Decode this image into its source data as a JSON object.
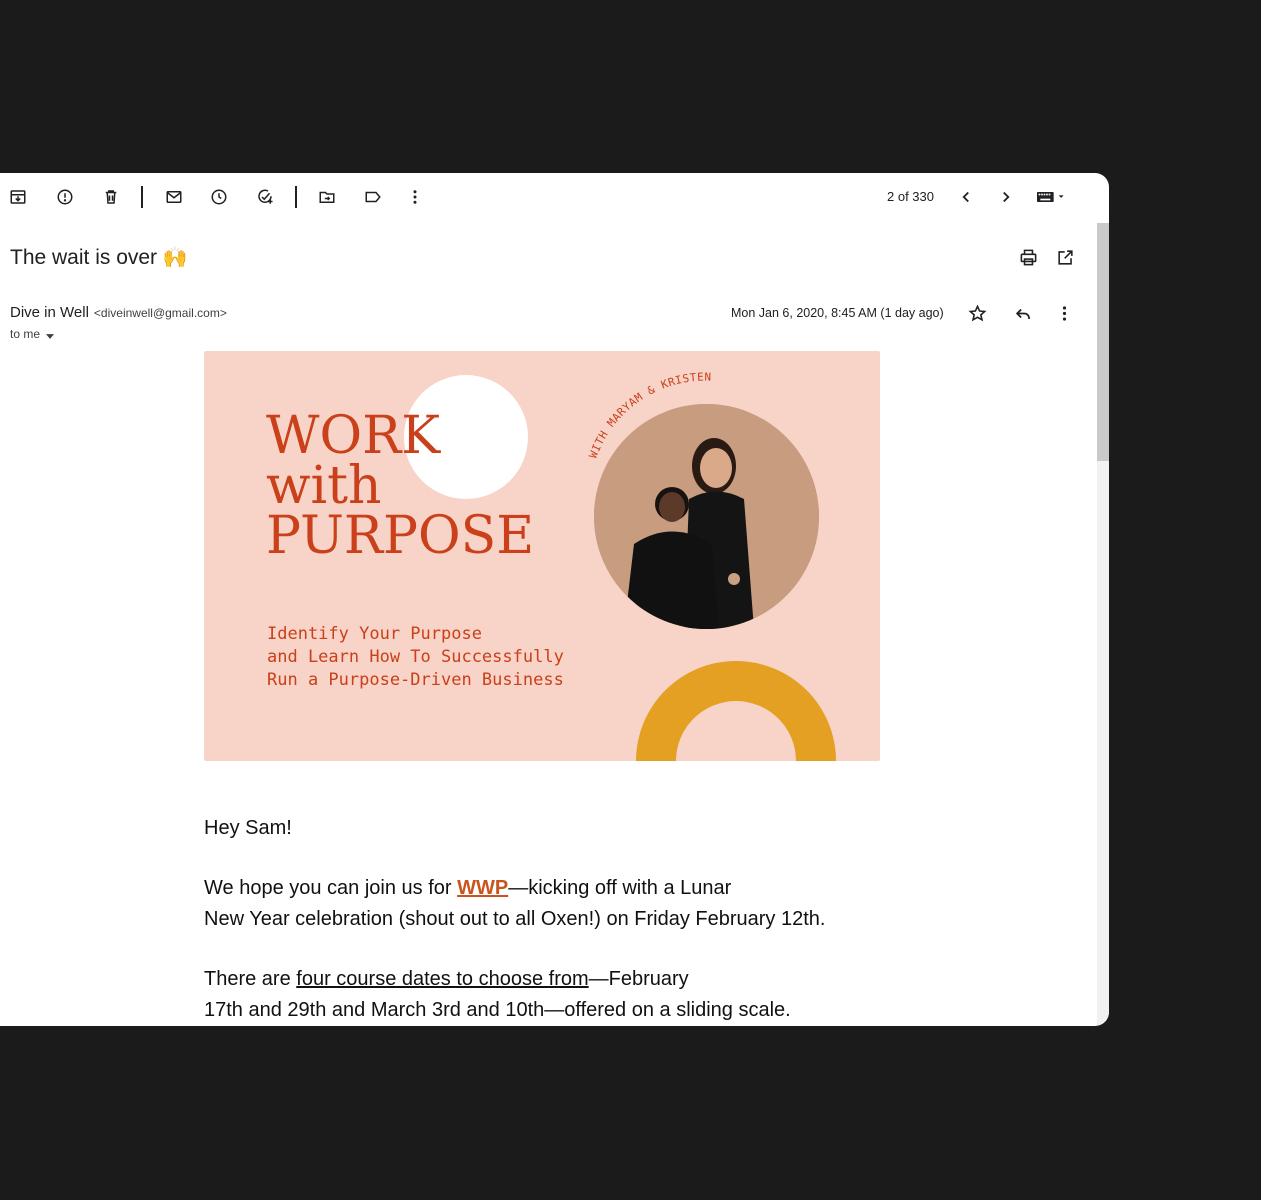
{
  "toolbar": {
    "pager_text": "2 of 330",
    "icons": [
      "archive-icon",
      "report-spam-icon",
      "delete-icon",
      "mark-unread-icon",
      "snooze-icon",
      "add-task-icon",
      "move-to-icon",
      "label-icon",
      "more-vert-icon",
      "chevron-left-icon",
      "chevron-right-icon",
      "keyboard-icon"
    ]
  },
  "email": {
    "subject": "The wait is over",
    "subject_emoji": "🙌",
    "sender_name": "Dive in Well",
    "sender_email": "<diveinwell@gmail.com>",
    "recipient": "to me",
    "date": "Mon Jan 6, 2020, 8:45 AM (1 day ago)"
  },
  "banner": {
    "title_lines": [
      "WORK",
      "with",
      "PURPOSE"
    ],
    "subtitle": "Identify Your Purpose\nand Learn How To Successfully\nRun a Purpose-Driven Business",
    "curved_text": "WITH MARYAM & KRISTEN",
    "colors": {
      "background": "#f8d3c7",
      "accent": "#c9401a",
      "arc": "#e3a023"
    }
  },
  "body": {
    "greeting": "Hey Sam!",
    "p1_before": "We hope you can join us for ",
    "p1_link": "WWP",
    "p1_after_line1": "—kicking off with a Lunar",
    "p1_line2": "New Year celebration (shout out to all Oxen!) on Friday February 12th.",
    "p2_before": "There are ",
    "p2_link": "four course dates to choose from",
    "p2_after_line1": "—February",
    "p2_line2": "17th and 29th and March 3rd and 10th—offered on a sliding scale."
  }
}
